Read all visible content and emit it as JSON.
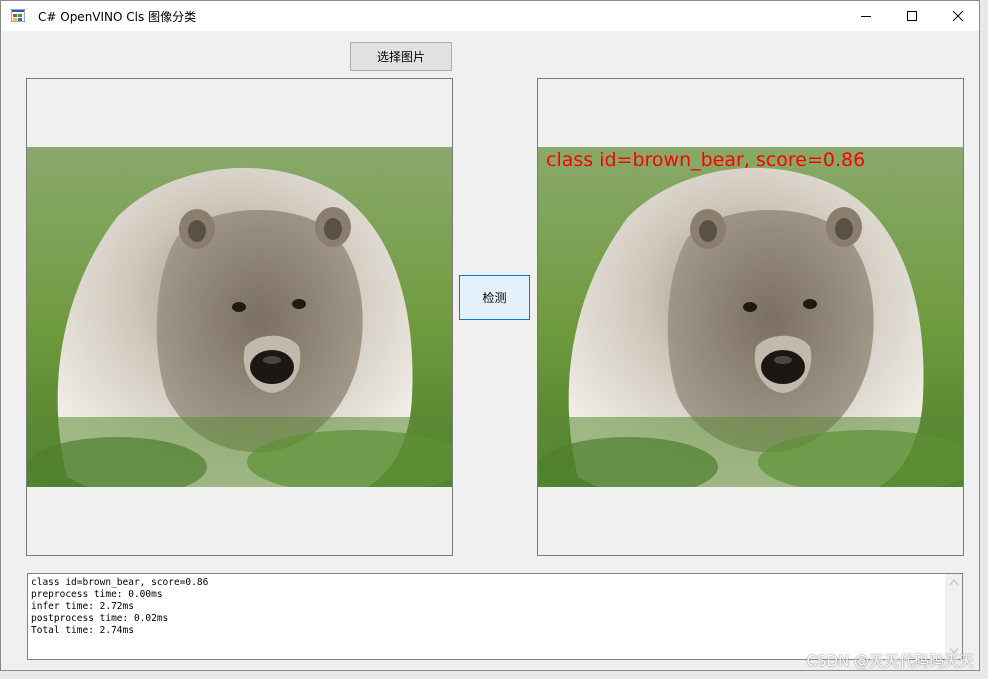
{
  "window": {
    "title": "C# OpenVINO Cls 图像分类",
    "controls": {
      "minimize": "minimize",
      "maximize": "maximize",
      "close": "close"
    }
  },
  "buttons": {
    "select_image": "选择图片",
    "detect": "检测"
  },
  "result_overlay": "class id=brown_bear, score=0.86",
  "log": {
    "lines": [
      "class id=brown_bear, score=0.86",
      "preprocess time: 0.00ms",
      "infer time: 2.72ms",
      "postprocess time: 0.02ms",
      "Total time: 2.74ms"
    ]
  },
  "watermark": "CSDN @天天代码码天天",
  "colors": {
    "overlay_text": "#ff0000",
    "focus_border": "#0078d7",
    "grass": "#6e9a3e",
    "fur": "#d8d2c8"
  },
  "icons": [
    "app-icon",
    "minimize-icon",
    "maximize-icon",
    "close-icon",
    "scroll-up-icon",
    "scroll-down-icon"
  ]
}
